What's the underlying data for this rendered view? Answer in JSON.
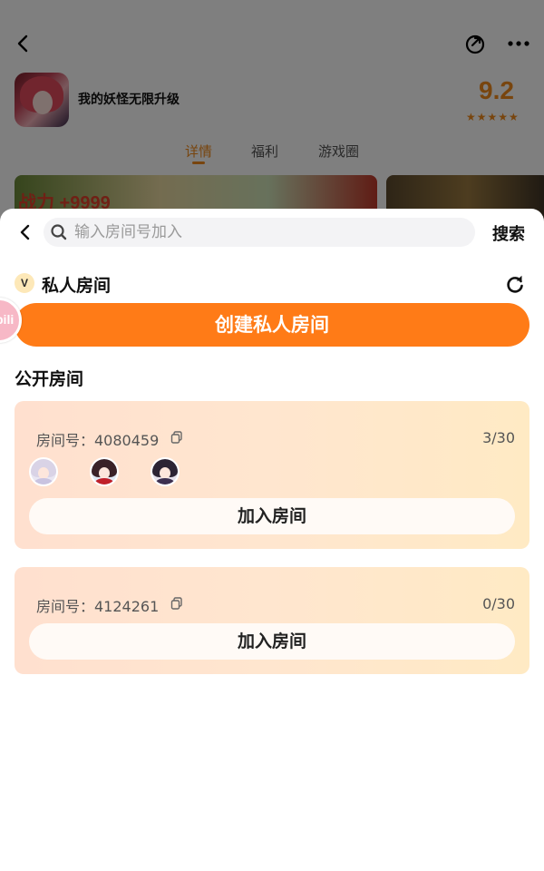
{
  "background_page": {
    "game_name": "我的妖怪无限升级",
    "score": "9.2",
    "stars": "★★★★★",
    "tabs": [
      {
        "label": "详情",
        "active": true
      },
      {
        "label": "福利",
        "active": false
      },
      {
        "label": "游戏圈",
        "active": false
      }
    ],
    "banner_text": "战力 +9999"
  },
  "sheet": {
    "search": {
      "placeholder": "输入房间号加入",
      "value": "",
      "button_label": "搜索"
    },
    "private_section": {
      "badge": "V",
      "title": "私人房间",
      "create_button": "创建私人房间"
    },
    "floating_bubble": "bili",
    "public_section": {
      "title": "公开房间",
      "rooms": [
        {
          "label": "房间号：4080459",
          "count": "3/30",
          "avatars": [
            {
              "hair": "#d9d3e6",
              "body": "#c9c3e0"
            },
            {
              "hair": "#3a2228",
              "body": "#c0202a"
            },
            {
              "hair": "#2c2434",
              "body": "#3d3050"
            }
          ],
          "join_button": "加入房间"
        },
        {
          "label": "房间号：4124261",
          "count": "0/30",
          "avatars": [],
          "join_button": "加入房间"
        }
      ]
    }
  },
  "colors": {
    "accent": "#ff7b17",
    "score_orange": "#f08a1c"
  }
}
